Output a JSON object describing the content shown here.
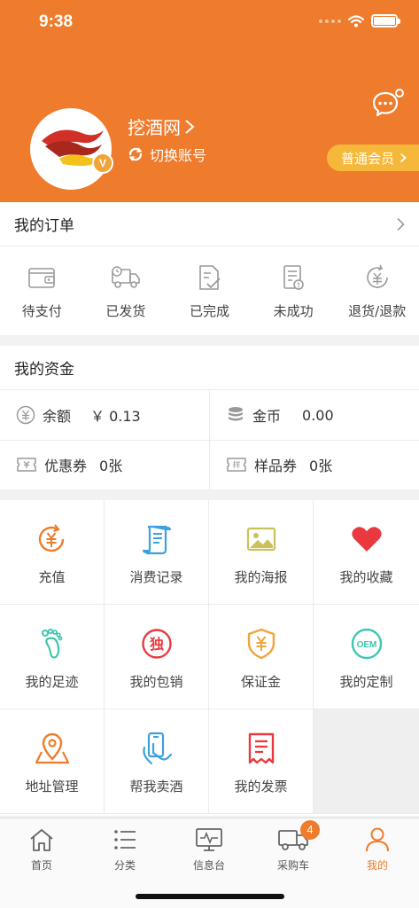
{
  "status_bar": {
    "time": "9:38"
  },
  "profile": {
    "username": "挖酒网",
    "switch_account": "切换账号",
    "badge": "V",
    "member_level": "普通会员"
  },
  "orders": {
    "title": "我的订单",
    "items": [
      {
        "label": "待支付",
        "icon": "wallet-icon"
      },
      {
        "label": "已发货",
        "icon": "truck-icon"
      },
      {
        "label": "已完成",
        "icon": "completed-icon"
      },
      {
        "label": "未成功",
        "icon": "failed-icon"
      },
      {
        "label": "退货/退款",
        "icon": "refund-icon"
      }
    ]
  },
  "funds": {
    "title": "我的资金",
    "balance": {
      "label": "余额",
      "value": "￥ 0.13"
    },
    "coins": {
      "label": "金币",
      "value": "0.00"
    },
    "coupons": {
      "label": "优惠券",
      "value": "0张"
    },
    "sample_coupons": {
      "label": "样品券",
      "value": "0张"
    }
  },
  "services": [
    {
      "label": "充值",
      "icon": "recharge-icon",
      "color": "#ef7b2c"
    },
    {
      "label": "消费记录",
      "icon": "scroll-icon",
      "color": "#3da1e0"
    },
    {
      "label": "我的海报",
      "icon": "image-icon",
      "color": "#c9c25a"
    },
    {
      "label": "我的收藏",
      "icon": "heart-icon",
      "color": "#e9393f"
    },
    {
      "label": "我的足迹",
      "icon": "footprint-icon",
      "color": "#3fc6b0"
    },
    {
      "label": "我的包销",
      "icon": "exclusive-icon",
      "color": "#e9393f"
    },
    {
      "label": "保证金",
      "icon": "shield-icon",
      "color": "#f0a43a"
    },
    {
      "label": "我的定制",
      "icon": "oem-icon",
      "color": "#3fc6b0"
    },
    {
      "label": "地址管理",
      "icon": "location-icon",
      "color": "#ef7b2c"
    },
    {
      "label": "帮我卖酒",
      "icon": "phone-hand-icon",
      "color": "#3da1e0"
    },
    {
      "label": "我的发票",
      "icon": "invoice-icon",
      "color": "#e9393f"
    }
  ],
  "tabbar": {
    "items": [
      {
        "label": "首页",
        "icon": "home-icon"
      },
      {
        "label": "分类",
        "icon": "list-icon"
      },
      {
        "label": "信息台",
        "icon": "monitor-icon"
      },
      {
        "label": "采购车",
        "icon": "cart-truck-icon"
      },
      {
        "label": "我的",
        "icon": "user-icon"
      }
    ],
    "cart_count": "4",
    "active_color": "#ef7b2c"
  }
}
